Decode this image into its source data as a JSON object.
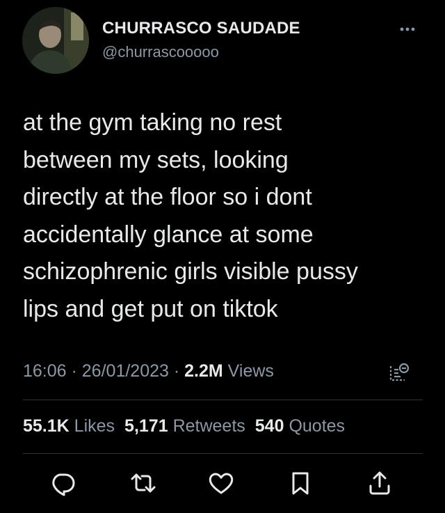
{
  "user": {
    "display_name": "CHURRASCO SAUDADE",
    "handle": "@churrascooooo"
  },
  "tweet": {
    "lines": [
      "at the gym taking no rest",
      "between my sets, looking",
      "directly at the floor so i dont",
      "accidentally glance at some",
      "schizophrenic girls visible pussy",
      "lips and get put on tiktok"
    ],
    "time": "16:06",
    "separator": " · ",
    "date": "26/01/2023",
    "views_count": "2.2M",
    "views_label": " Views"
  },
  "stats": {
    "likes_count": "55.1K",
    "likes_label": "Likes",
    "retweets_count": "5,171",
    "retweets_label": "Retweets",
    "quotes_count": "540",
    "quotes_label": "Quotes"
  },
  "icons": {
    "more": "more-icon",
    "analytics": "analytics-icon",
    "reply": "reply-icon",
    "retweet": "retweet-icon",
    "like": "heart-icon",
    "bookmark": "bookmark-icon",
    "share": "share-icon"
  },
  "colors": {
    "background": "#000000",
    "primary_text": "#e7e9ea",
    "secondary_text": "#8b98a5",
    "divider": "#2f3336"
  }
}
